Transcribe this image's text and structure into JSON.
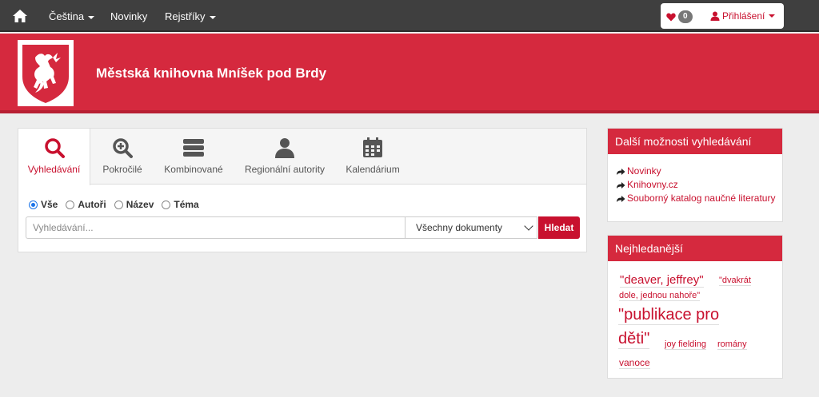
{
  "nav": {
    "items": [
      "Čeština",
      "Novinky",
      "Rejstříky"
    ],
    "favorites_count": "0",
    "login_label": "Přihlášení"
  },
  "header": {
    "title": "Městská knihovna Mníšek pod Brdy"
  },
  "search": {
    "tabs": [
      {
        "label": "Vyhledávání",
        "icon": "search-icon"
      },
      {
        "label": "Pokročilé",
        "icon": "zoom-plus-icon"
      },
      {
        "label": "Kombinované",
        "icon": "server-icon"
      },
      {
        "label": "Regionální autority",
        "icon": "user-icon"
      },
      {
        "label": "Kalendárium",
        "icon": "calendar-icon"
      }
    ],
    "radios": [
      "Vše",
      "Autoři",
      "Název",
      "Téma"
    ],
    "placeholder": "Vyhledávání...",
    "select_value": "Všechny dokumenty",
    "button_label": "Hledat"
  },
  "more_options": {
    "title": "Další možnosti vyhledávání",
    "links": [
      "Novinky",
      "Knihovny.cz",
      "Souborný katalog naučné literatury"
    ]
  },
  "popular": {
    "title": "Nejhledanější",
    "tags": [
      "\"deaver, jeffrey\"",
      "\"dvakrát",
      "dole, jednou nahoře\"",
      "\"publikace pro",
      "děti\"",
      "joy fielding",
      "romány",
      "vanoce"
    ]
  },
  "colors": {
    "brand_red": "#d5293e",
    "link_red": "#c8102e",
    "navbar": "#3f3f3f"
  }
}
